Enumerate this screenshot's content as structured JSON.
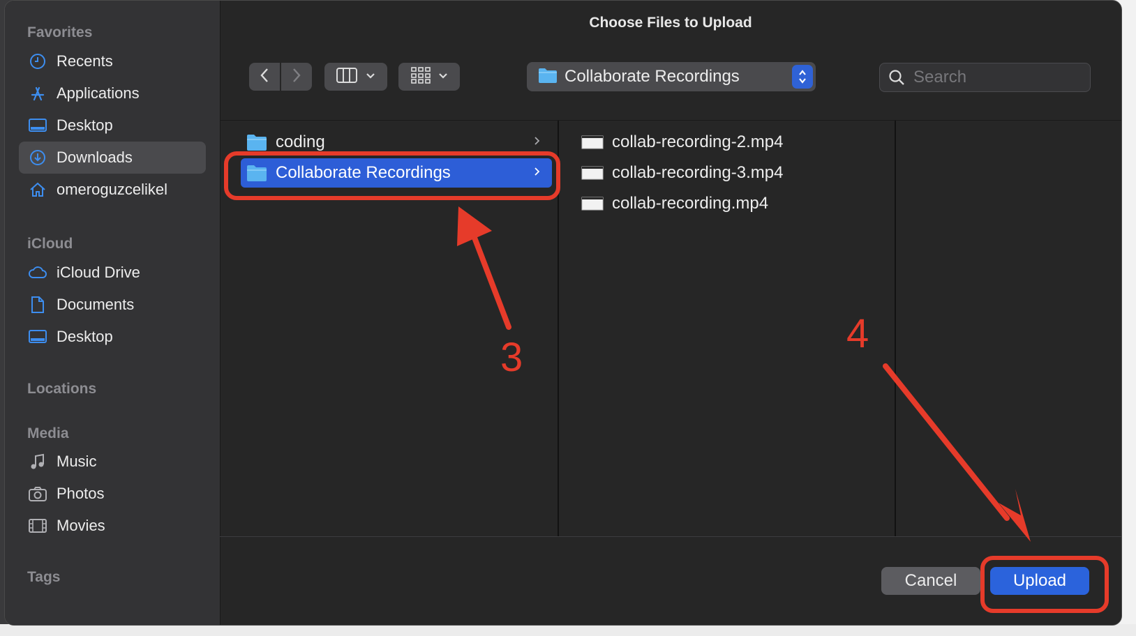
{
  "window": {
    "title": "Choose Files to Upload"
  },
  "sidebar": {
    "sections": [
      {
        "heading": "Favorites",
        "items": [
          {
            "label": "Recents",
            "icon": "clock-icon",
            "selected": false
          },
          {
            "label": "Applications",
            "icon": "applications-icon",
            "selected": false
          },
          {
            "label": "Desktop",
            "icon": "desktop-icon",
            "selected": false
          },
          {
            "label": "Downloads",
            "icon": "downloads-icon",
            "selected": true
          },
          {
            "label": "omeroguzcelikel",
            "icon": "home-icon",
            "selected": false
          }
        ]
      },
      {
        "heading": "iCloud",
        "items": [
          {
            "label": "iCloud Drive",
            "icon": "cloud-icon",
            "selected": false
          },
          {
            "label": "Documents",
            "icon": "document-icon",
            "selected": false
          },
          {
            "label": "Desktop",
            "icon": "desktop-icon",
            "selected": false
          }
        ]
      },
      {
        "heading": "Locations",
        "items": []
      },
      {
        "heading": "Media",
        "items": [
          {
            "label": "Music",
            "icon": "music-note-icon",
            "selected": false
          },
          {
            "label": "Photos",
            "icon": "camera-icon",
            "selected": false
          },
          {
            "label": "Movies",
            "icon": "film-icon",
            "selected": false
          }
        ]
      },
      {
        "heading": "Tags",
        "items": []
      }
    ]
  },
  "toolbar": {
    "path_label": "Collaborate Recordings",
    "search_placeholder": "Search"
  },
  "browser": {
    "column1": [
      {
        "label": "coding",
        "selected": false
      },
      {
        "label": "Collaborate Recordings",
        "selected": true
      }
    ],
    "column2": [
      {
        "label": "collab-recording-2.mp4"
      },
      {
        "label": "collab-recording-3.mp4"
      },
      {
        "label": "collab-recording.mp4"
      }
    ]
  },
  "buttons": {
    "cancel": "Cancel",
    "upload": "Upload"
  },
  "annotations": {
    "step3": "3",
    "step4": "4",
    "color": "#e63b2a"
  },
  "colors": {
    "accent": "#2b63dc",
    "folder": "#5ab4f0",
    "sidebar_icon": "#3d8ef0"
  }
}
